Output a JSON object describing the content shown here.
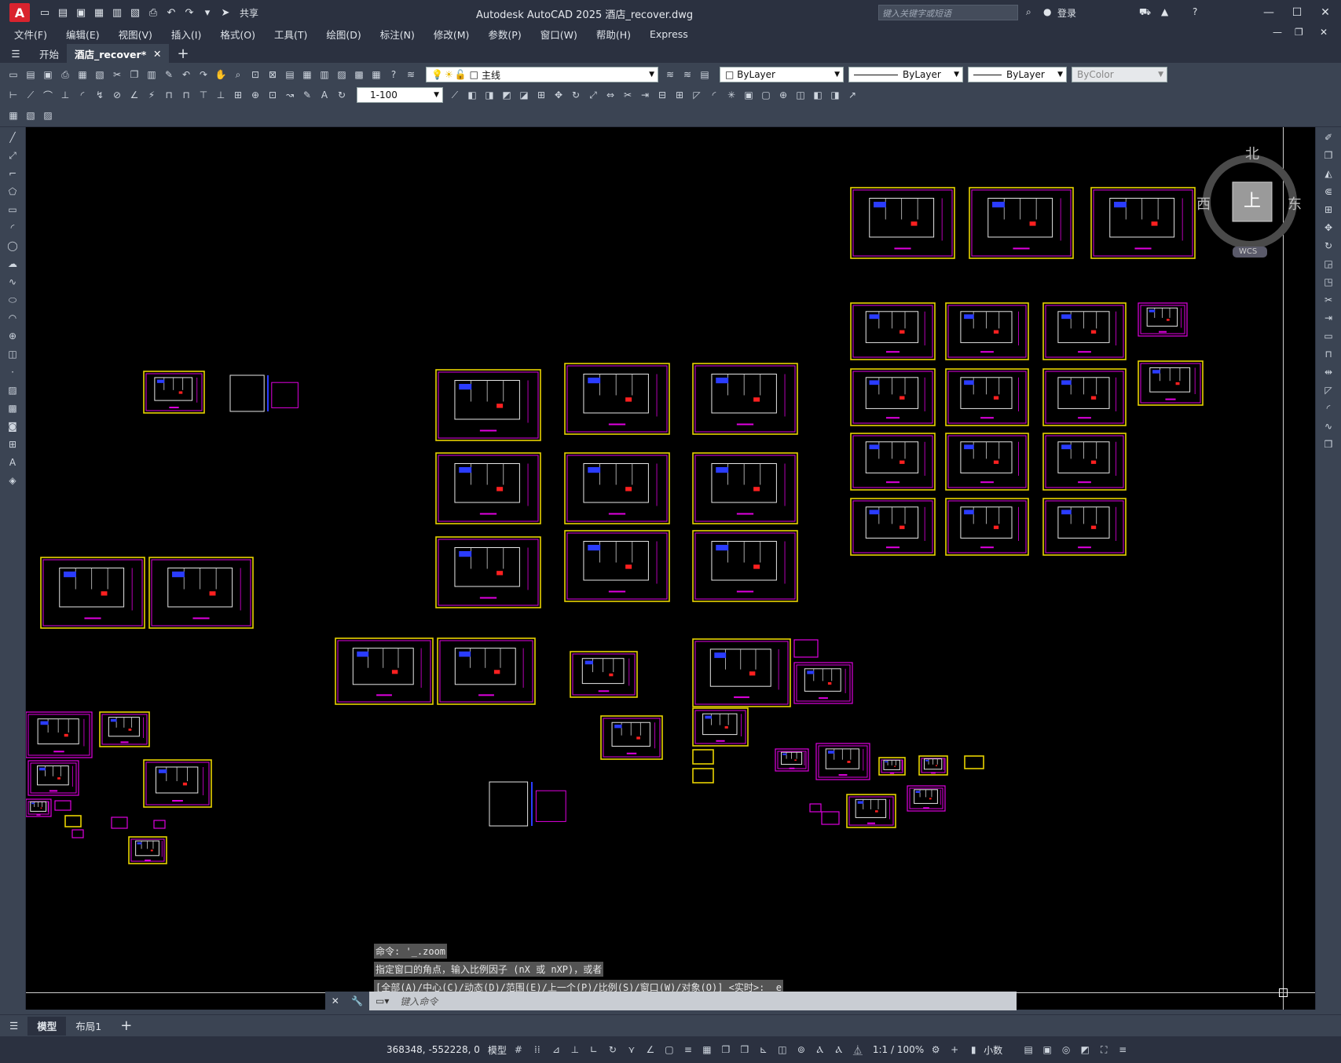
{
  "window": {
    "app_logo": "A",
    "title": "Autodesk AutoCAD 2025   酒店_recover.dwg",
    "share_label": "共享",
    "search_placeholder": "键入关键字或短语",
    "login_label": "登录"
  },
  "menu": [
    "文件(F)",
    "编辑(E)",
    "视图(V)",
    "插入(I)",
    "格式(O)",
    "工具(T)",
    "绘图(D)",
    "标注(N)",
    "修改(M)",
    "参数(P)",
    "窗口(W)",
    "帮助(H)",
    "Express"
  ],
  "tabs": {
    "start": "开始",
    "document": "酒店_recover*",
    "new_tab": "+"
  },
  "toolbar": {
    "layer_name": "主线",
    "color": "ByLayer",
    "linetype": "ByLayer",
    "lineweight": "ByLayer",
    "plotstyle": "ByColor",
    "dimstyle_scale": "1-100"
  },
  "viewcube": {
    "north": "北",
    "south": "",
    "west": "西",
    "east": "东",
    "top_face": "上",
    "wcs": "WCS"
  },
  "command": {
    "history": [
      "命令: '_.zoom",
      "指定窗口的角点，输入比例因子 (nX 或 nXP)，或者",
      "[全部(A)/中心(C)/动态(D)/范围(E)/上一个(P)/比例(S)/窗口(W)/对象(O)] <实时>: _e"
    ],
    "input_placeholder": "键入命令"
  },
  "layout_tabs": {
    "model": "模型",
    "layout1": "布局1",
    "add": "+"
  },
  "status": {
    "coordinates": "368348, -552228, 0",
    "space": "模型",
    "annotation_scale": "1:1 / 100%",
    "units": "小数"
  },
  "colors": {
    "canvas": "#000000",
    "frame_yellow": "#e8d300",
    "frame_magenta": "#e000e0",
    "ui_dark": "#2b3140",
    "ui_mid": "#3b4453"
  }
}
